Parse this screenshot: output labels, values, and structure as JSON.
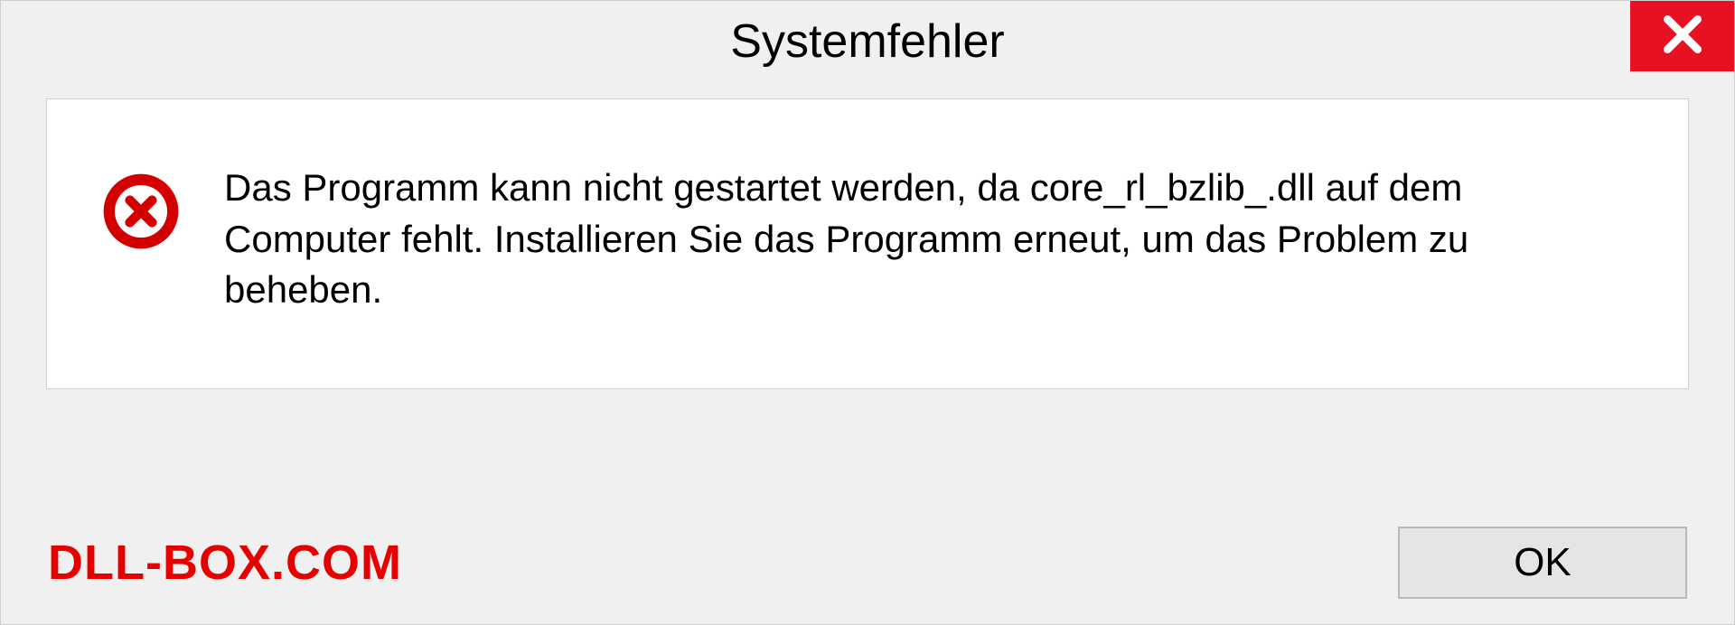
{
  "dialog": {
    "title": "Systemfehler",
    "message": "Das Programm kann nicht gestartet werden, da core_rl_bzlib_.dll auf dem Computer fehlt. Installieren Sie das Programm erneut, um das Problem zu beheben.",
    "ok_label": "OK"
  },
  "watermark": "DLL-BOX.COM",
  "colors": {
    "close_bg": "#e81123",
    "error_red": "#d40000",
    "watermark_red": "#e60000"
  }
}
